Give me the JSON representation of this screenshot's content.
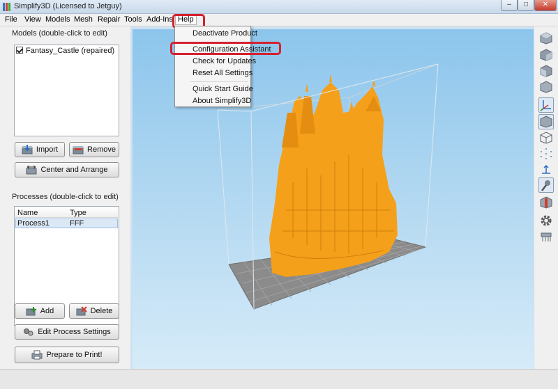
{
  "window": {
    "title": "Simplify3D (Licensed to Jetguy)",
    "minimize_symbol": "–",
    "maximize_symbol": "□",
    "close_symbol": "✕"
  },
  "menubar": {
    "items": [
      "File",
      "View",
      "Models",
      "Mesh",
      "Repair",
      "Tools",
      "Add-Ins",
      "Help"
    ]
  },
  "help_menu": {
    "items": [
      "Deactivate Product",
      "Configuration Assistant",
      "Check for Updates",
      "Reset All Settings",
      "Quick Start Guide",
      "About Simplify3D"
    ]
  },
  "models_panel": {
    "heading": "Models (double-click to edit)",
    "items": [
      {
        "label": "Fantasy_Castle (repaired)",
        "checked": true
      }
    ],
    "import_label": "Import",
    "remove_label": "Remove",
    "center_label": "Center and Arrange"
  },
  "processes_panel": {
    "heading": "Processes (double-click to edit)",
    "columns": [
      "Name",
      "Type"
    ],
    "rows": [
      {
        "name": "Process1",
        "type": "FFF"
      }
    ],
    "add_label": "Add",
    "delete_label": "Delete",
    "edit_label": "Edit Process Settings",
    "print_label": "Prepare to Print!"
  },
  "colors": {
    "model": "#f7a21b",
    "highlight": "#d6202f",
    "bed": "#8b8b8b"
  },
  "toolbar_icons": [
    "view-front-icon",
    "view-back-icon",
    "view-top-icon",
    "view-side-icon",
    "axes-icon",
    "solid-view-icon",
    "wireframe-icon",
    "points-icon",
    "normals-icon",
    "support-icon",
    "cross-section-icon",
    "settings-gear-icon",
    "layout-icon"
  ]
}
